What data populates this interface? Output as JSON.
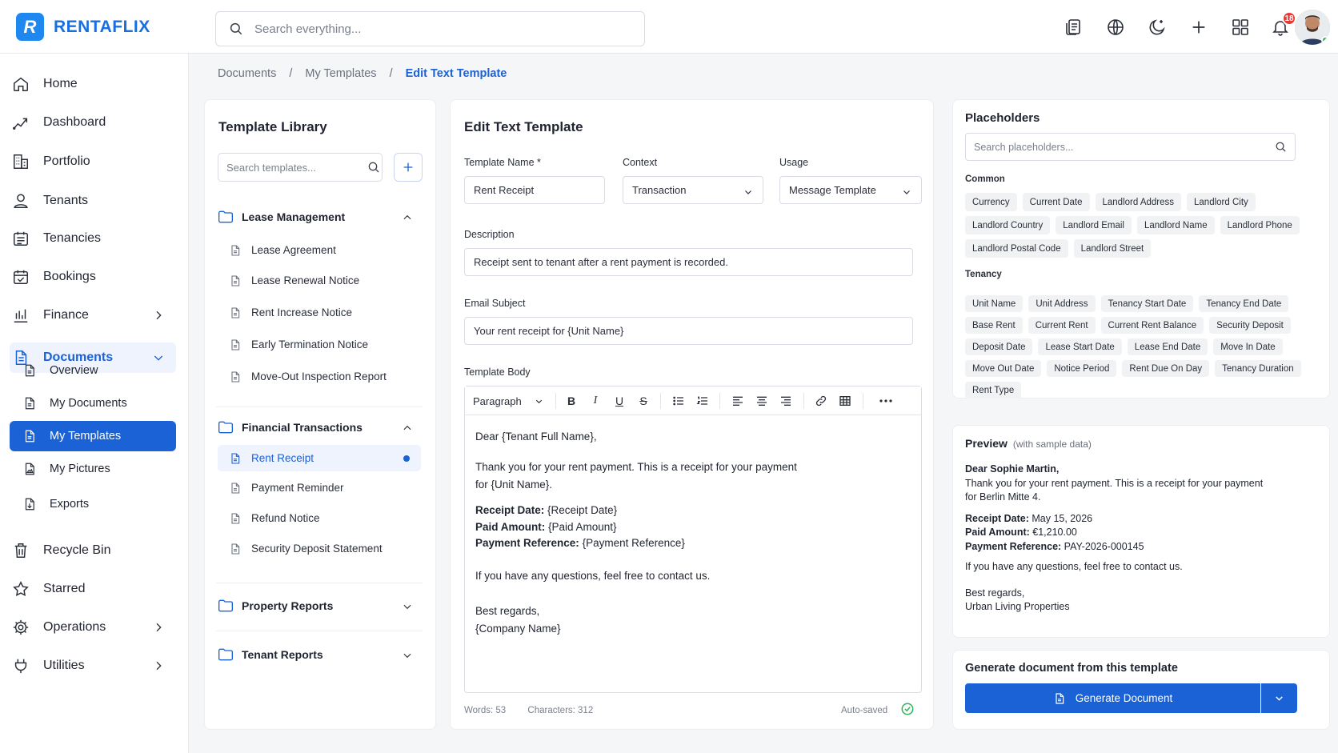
{
  "app": {
    "logo_letter": "R",
    "brand": "RENTAFLIX",
    "brand_color": "#1a62d6"
  },
  "search": {
    "placeholder": "Search everything..."
  },
  "top_icons": [
    "document-icon",
    "globe-icon",
    "moon-icon",
    "plus-icon",
    "grid-icon",
    "bell-icon"
  ],
  "notifications": {
    "count": "18"
  },
  "sidebar": {
    "items": [
      {
        "label": "Home",
        "icon": "home-icon"
      },
      {
        "label": "Dashboard",
        "icon": "chart-icon"
      },
      {
        "label": "Portfolio",
        "icon": "building-icon"
      },
      {
        "label": "Tenants",
        "icon": "person-icon"
      },
      {
        "label": "Tenancies",
        "icon": "calendar-list-icon"
      },
      {
        "label": "Bookings",
        "icon": "calendar-check-icon"
      },
      {
        "label": "Finance",
        "icon": "finance-icon"
      },
      {
        "label": "Documents",
        "icon": "document-icon"
      },
      {
        "label": "Recycle Bin",
        "icon": "trash-icon"
      },
      {
        "label": "Starred",
        "icon": "star-icon"
      },
      {
        "label": "Operations",
        "icon": "gear-icon"
      },
      {
        "label": "Utilities",
        "icon": "plug-icon"
      }
    ],
    "documents_sub": [
      "Overview",
      "My Documents",
      "My Templates",
      "My Pictures",
      "Exports"
    ]
  },
  "breadcrumb": [
    "Documents",
    "My Templates",
    "Edit Text Template"
  ],
  "library": {
    "title": "Template Library",
    "search_placeholder": "Search templates...",
    "folders": [
      {
        "name": "Lease Management",
        "expanded": true,
        "items": [
          "Lease Agreement",
          "Lease Renewal Notice",
          "Rent Increase Notice",
          "Early Termination Notice",
          "Move-Out Inspection Report"
        ]
      },
      {
        "name": "Financial Transactions",
        "expanded": true,
        "items": [
          "Rent Receipt",
          "Payment Reminder",
          "Refund Notice",
          "Security Deposit Statement"
        ]
      },
      {
        "name": "Property Reports",
        "expanded": false,
        "items": []
      },
      {
        "name": "Tenant Reports",
        "expanded": false,
        "items": []
      }
    ]
  },
  "editor": {
    "title": "Edit Text Template",
    "name_label": "Template Name",
    "required_mark": "*",
    "name_value": "Rent Receipt",
    "context_label": "Context",
    "context_value": "Transaction",
    "usage_label": "Usage",
    "usage_value": "Message Template",
    "description_label": "Description",
    "description_value": "Receipt sent to tenant after a rent payment is recorded.",
    "subject_label": "Email Subject",
    "subject_value": "Your rent receipt for {Unit Name}",
    "body_label": "Template Body",
    "paragraph_style": "Paragraph",
    "body": {
      "greeting": "Dear {Tenant Full Name},",
      "line1": "Thank you for your rent payment. This is a receipt for your payment",
      "line2": "for {Unit Name}.",
      "receipt_date_label": "Receipt Date:",
      "receipt_date_value": " {Receipt Date}",
      "paid_amount_label": "Paid Amount:",
      "paid_amount_value": " {Paid Amount}",
      "payment_ref_label": "Payment Reference:",
      "payment_ref_value": " {Payment Reference}",
      "questions": "If you have any questions, feel free to contact us.",
      "regards": "Best regards,",
      "company": "{Company Name}"
    },
    "words": "Words: 53",
    "characters": "Characters: 312",
    "autosaved": "Auto-saved"
  },
  "placeholders": {
    "title": "Placeholders",
    "search_placeholder": "Search placeholders...",
    "common_label": "Common",
    "common": [
      "Currency",
      "Current Date",
      "Landlord Address",
      "Landlord City",
      "Landlord Country",
      "Landlord Email",
      "Landlord Name",
      "Landlord Phone",
      "Landlord Postal Code",
      "Landlord Street"
    ],
    "tenancy_label": "Tenancy",
    "tenancy": [
      "Unit Name",
      "Unit Address",
      "Tenancy Start Date",
      "Tenancy End Date",
      "Base Rent",
      "Current Rent",
      "Current Rent Balance",
      "Security Deposit",
      "Deposit Date",
      "Lease Start Date",
      "Lease End Date",
      "Move In Date",
      "Move Out Date",
      "Notice Period",
      "Rent Due On Day",
      "Tenancy Duration",
      "Rent Type"
    ]
  },
  "preview": {
    "title": "Preview",
    "subtitle": "(with sample data)",
    "greeting": "Dear Sophie Martin,",
    "line1": "Thank you for your rent payment. This is a receipt for your payment",
    "line2": "for Berlin Mitte 4.",
    "receipt_date_label": "Receipt Date:",
    "receipt_date_value": " May 15, 2026",
    "paid_amount_label": "Paid Amount:",
    "paid_amount_value": " €1,210.00",
    "payment_ref_label": "Payment Reference:",
    "payment_ref_value": " PAY-2026-000145",
    "questions": "If you have any questions, feel free to contact us.",
    "regards": "Best regards,",
    "company": "Urban Living Properties"
  },
  "generate": {
    "title": "Generate document from this template",
    "button": "Generate Document"
  }
}
